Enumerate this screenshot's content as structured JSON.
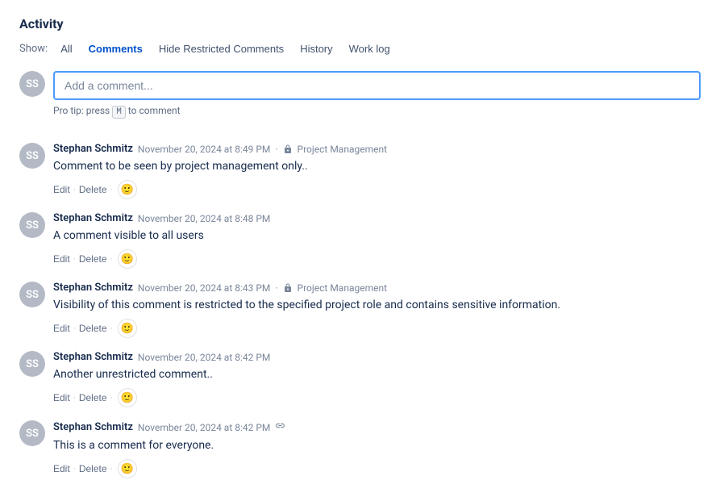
{
  "activity": {
    "title": "Activity",
    "show_label": "Show:",
    "filters": [
      {
        "id": "all",
        "label": "All",
        "active": false
      },
      {
        "id": "comments",
        "label": "Comments",
        "active": true
      },
      {
        "id": "hide-restricted",
        "label": "Hide Restricted Comments",
        "active": false
      },
      {
        "id": "history",
        "label": "History",
        "active": false
      },
      {
        "id": "worklog",
        "label": "Work log",
        "active": false
      }
    ],
    "comment_input_placeholder": "Add a comment...",
    "pro_tip_text": "Pro tip: press",
    "pro_tip_key": "M",
    "pro_tip_suffix": "to comment",
    "comments": [
      {
        "id": 1,
        "author": "Stephan Schmitz",
        "timestamp": "November 20, 2024 at 8:49 PM",
        "restricted": true,
        "restriction_label": "Project Management",
        "text": "Comment to be seen by project management only..",
        "actions": [
          "Edit",
          "Delete"
        ],
        "has_emoji": true,
        "has_link": false
      },
      {
        "id": 2,
        "author": "Stephan Schmitz",
        "timestamp": "November 20, 2024 at 8:48 PM",
        "restricted": false,
        "restriction_label": "",
        "text": "A comment visible to all users",
        "actions": [
          "Edit",
          "Delete"
        ],
        "has_emoji": true,
        "has_link": false
      },
      {
        "id": 3,
        "author": "Stephan Schmitz",
        "timestamp": "November 20, 2024 at 8:43 PM",
        "restricted": true,
        "restriction_label": "Project Management",
        "text": "Visibility of this comment is restricted to the specified project role and contains sensitive information.",
        "actions": [
          "Edit",
          "Delete"
        ],
        "has_emoji": true,
        "has_link": false
      },
      {
        "id": 4,
        "author": "Stephan Schmitz",
        "timestamp": "November 20, 2024 at 8:42 PM",
        "restricted": false,
        "restriction_label": "",
        "text": "Another unrestricted comment..",
        "actions": [
          "Edit",
          "Delete"
        ],
        "has_emoji": true,
        "has_link": false
      },
      {
        "id": 5,
        "author": "Stephan Schmitz",
        "timestamp": "November 20, 2024 at 8:42 PM",
        "restricted": false,
        "restriction_label": "",
        "text": "This is a comment for everyone.",
        "actions": [
          "Edit",
          "Delete"
        ],
        "has_emoji": true,
        "has_link": true
      }
    ]
  }
}
